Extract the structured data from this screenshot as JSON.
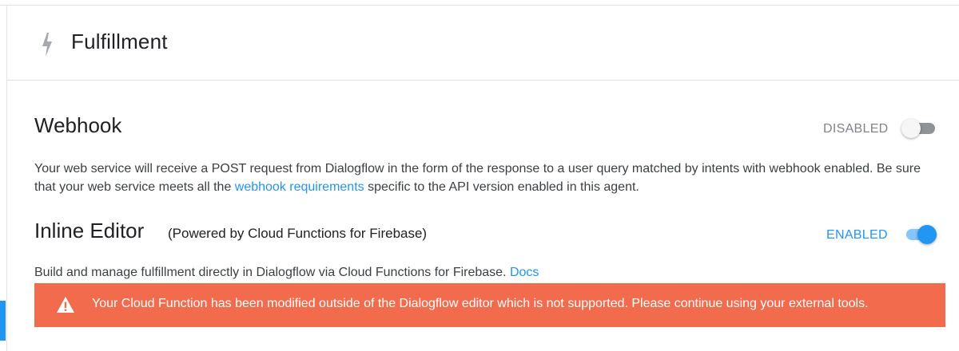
{
  "header": {
    "title": "Fulfillment",
    "icon": "bolt-icon"
  },
  "webhook": {
    "title": "Webhook",
    "status_label": "DISABLED",
    "enabled": false,
    "description_before": "Your web service will receive a POST request from Dialogflow in the form of the response to a user query matched by intents with webhook enabled. Be sure that your web service meets all the ",
    "link_text": "webhook requirements",
    "description_after": " specific to the API version enabled in this agent."
  },
  "inline_editor": {
    "title": "Inline Editor",
    "subtitle": "(Powered by Cloud Functions for Firebase)",
    "status_label": "ENABLED",
    "enabled": true,
    "description": "Build and manage fulfillment directly in Dialogflow via Cloud Functions for Firebase. ",
    "link_text": "Docs",
    "warning": {
      "icon": "warning-icon",
      "text": "Your Cloud Function has been modified outside of the Dialogflow editor which is not supported. Please continue using your external tools."
    }
  },
  "colors": {
    "accent": "#2196f3",
    "warning_bg": "#f26b4d",
    "text": "#202124",
    "muted": "#7f8489"
  }
}
